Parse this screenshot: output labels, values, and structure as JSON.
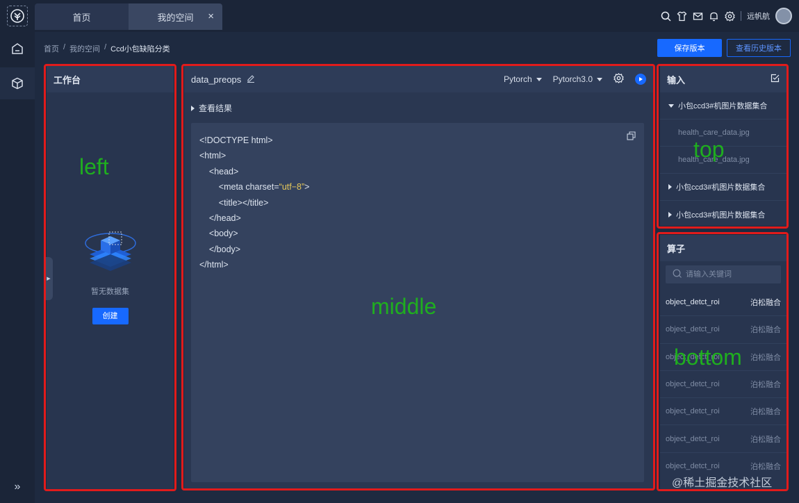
{
  "tabs": [
    {
      "label": "首页"
    },
    {
      "label": "我的空间",
      "close": "×"
    }
  ],
  "user": {
    "name": "远帆航"
  },
  "breadcrumb": [
    "首页",
    "我的空间",
    "Ccd小包缺陷分类"
  ],
  "breadcrumb_sep": "/",
  "actions": {
    "save": "保存版本",
    "history": "查看历史版本"
  },
  "left_panel": {
    "title": "工作台",
    "empty_text": "暂无数据集",
    "create_label": "创建"
  },
  "editor": {
    "name": "data_preops",
    "framework": "Pytorch",
    "version": "Pytorch3.0",
    "results_label": "查看结果",
    "code_lines": [
      "<!DOCTYPE html>",
      "<html>",
      "<head>",
      "<meta charset=",
      "<title></title>",
      "</head>",
      "<body>",
      "</body>",
      "</html>"
    ],
    "charset_value": "“utf−8”",
    "charset_close": ">"
  },
  "input_panel": {
    "title": "输入",
    "groups": [
      {
        "label": "小包ccd3#机图片数据集合",
        "expanded": true,
        "files": [
          "health_care_data.jpg",
          "health_care_data.jpg"
        ]
      },
      {
        "label": "小包ccd3#机图片数据集合",
        "expanded": false
      },
      {
        "label": "小包ccd3#机图片数据集合",
        "expanded": false
      }
    ]
  },
  "operator_panel": {
    "title": "算子",
    "search_placeholder": "请输入关键词",
    "rows": [
      {
        "name": "object_detct_roi",
        "desc": "泊松融合"
      },
      {
        "name": "object_detct_roi",
        "desc": "泊松融合"
      },
      {
        "name": "object_detct_roi",
        "desc": "泊松融合"
      },
      {
        "name": "object_detct_roi",
        "desc": "泊松融合"
      },
      {
        "name": "object_detct_roi",
        "desc": "泊松融合"
      },
      {
        "name": "object_detct_roi",
        "desc": "泊松融合"
      },
      {
        "name": "object_detct_roi",
        "desc": "泊松融合"
      }
    ]
  },
  "annotations": {
    "left": "left",
    "middle": "middle",
    "top": "top",
    "bottom": "bottom"
  },
  "watermark": "@稀土掘金技术社区",
  "colors": {
    "accent": "#1769ff",
    "annotation_box": "#e11b1b",
    "annotation_text": "#1fae1f"
  }
}
